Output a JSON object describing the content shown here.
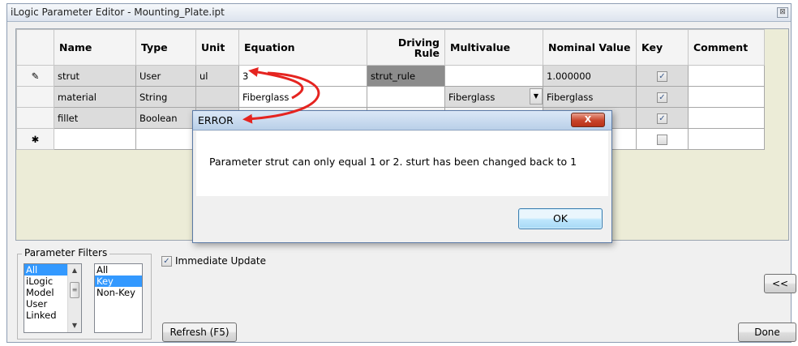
{
  "window": {
    "title": "iLogic Parameter Editor - Mounting_Plate.ipt",
    "close_glyph": "⊠"
  },
  "grid": {
    "columns": [
      "Name",
      "Type",
      "Unit",
      "Equation",
      "Driving Rule",
      "Multivalue",
      "Nominal Value",
      "Key",
      "Comment"
    ],
    "rows": [
      {
        "indicator": "✎",
        "name": "strut",
        "type": "User",
        "unit": "ul",
        "equation": "3",
        "driving_rule": "strut_rule",
        "multivalue": "",
        "nominal_value": "1.000000",
        "key": true,
        "comment": ""
      },
      {
        "indicator": "",
        "name": "material",
        "type": "String",
        "unit": "",
        "equation": "Fiberglass",
        "driving_rule": "",
        "multivalue": "Fiberglass",
        "nominal_value": "Fiberglass",
        "key": true,
        "comment": ""
      },
      {
        "indicator": "",
        "name": "fillet",
        "type": "Boolean",
        "unit": "",
        "equation": "",
        "driving_rule": "",
        "multivalue": "",
        "nominal_value": "",
        "key": true,
        "comment": ""
      }
    ],
    "new_row_indicator": "✱",
    "check_glyph": "✓"
  },
  "filters": {
    "label": "Parameter Filters",
    "list1": [
      "All",
      "iLogic",
      "Model",
      "User",
      "Linked"
    ],
    "list1_selected": "All",
    "list2": [
      "All",
      "Key",
      "Non-Key"
    ],
    "list2_selected": "Key"
  },
  "immediate_update": {
    "label": "Immediate Update",
    "checked": true
  },
  "buttons": {
    "refresh": "Refresh (F5)",
    "done": "Done",
    "collapse": "<<"
  },
  "dialog": {
    "title": "ERROR",
    "message": "Parameter strut can only equal 1 or 2. sturt has been changed back to 1",
    "ok": "OK",
    "close": "X"
  },
  "colors": {
    "arrow": "#e52420",
    "selection": "#3399ff"
  }
}
